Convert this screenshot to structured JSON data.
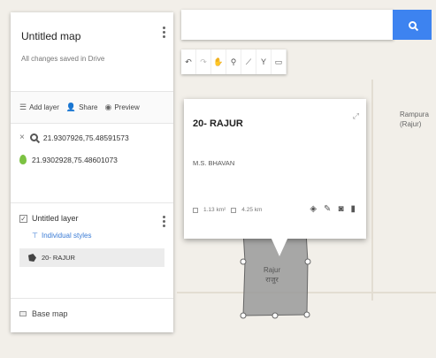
{
  "panel": {
    "title": "Untitled map",
    "status": "All changes saved in Drive",
    "actions": [
      {
        "label": "Add layer",
        "icon": "add-layer-icon"
      },
      {
        "label": "Share",
        "icon": "share-icon"
      },
      {
        "label": "Preview",
        "icon": "preview-icon"
      }
    ],
    "search_query": "21.9307926,75.48591573",
    "search_result": "21.9302928,75.48601073",
    "layer": {
      "name": "Untitled layer",
      "styles_link": "Individual styles",
      "feature": "20- RAJUR"
    },
    "basemap": "Base map"
  },
  "search": {
    "value": "",
    "placeholder": ""
  },
  "toolbar": [
    "undo-icon",
    "redo-icon",
    "hand-icon",
    "marker-icon",
    "draw-line-icon",
    "route-icon",
    "ruler-icon"
  ],
  "map": {
    "polygon_label_en": "Rajur",
    "polygon_label_local": "राजुर",
    "place_label_1": "Rampura",
    "place_label_2": "(Rajur)"
  },
  "card": {
    "title": "20- RAJUR",
    "description": "M.S. BHAVAN",
    "area": "1.13 km²",
    "perimeter": "4.25 km"
  },
  "colors": {
    "accent": "#3d83f0",
    "pin": "#7cc242",
    "polygon_fill": "#9a9a9a"
  }
}
